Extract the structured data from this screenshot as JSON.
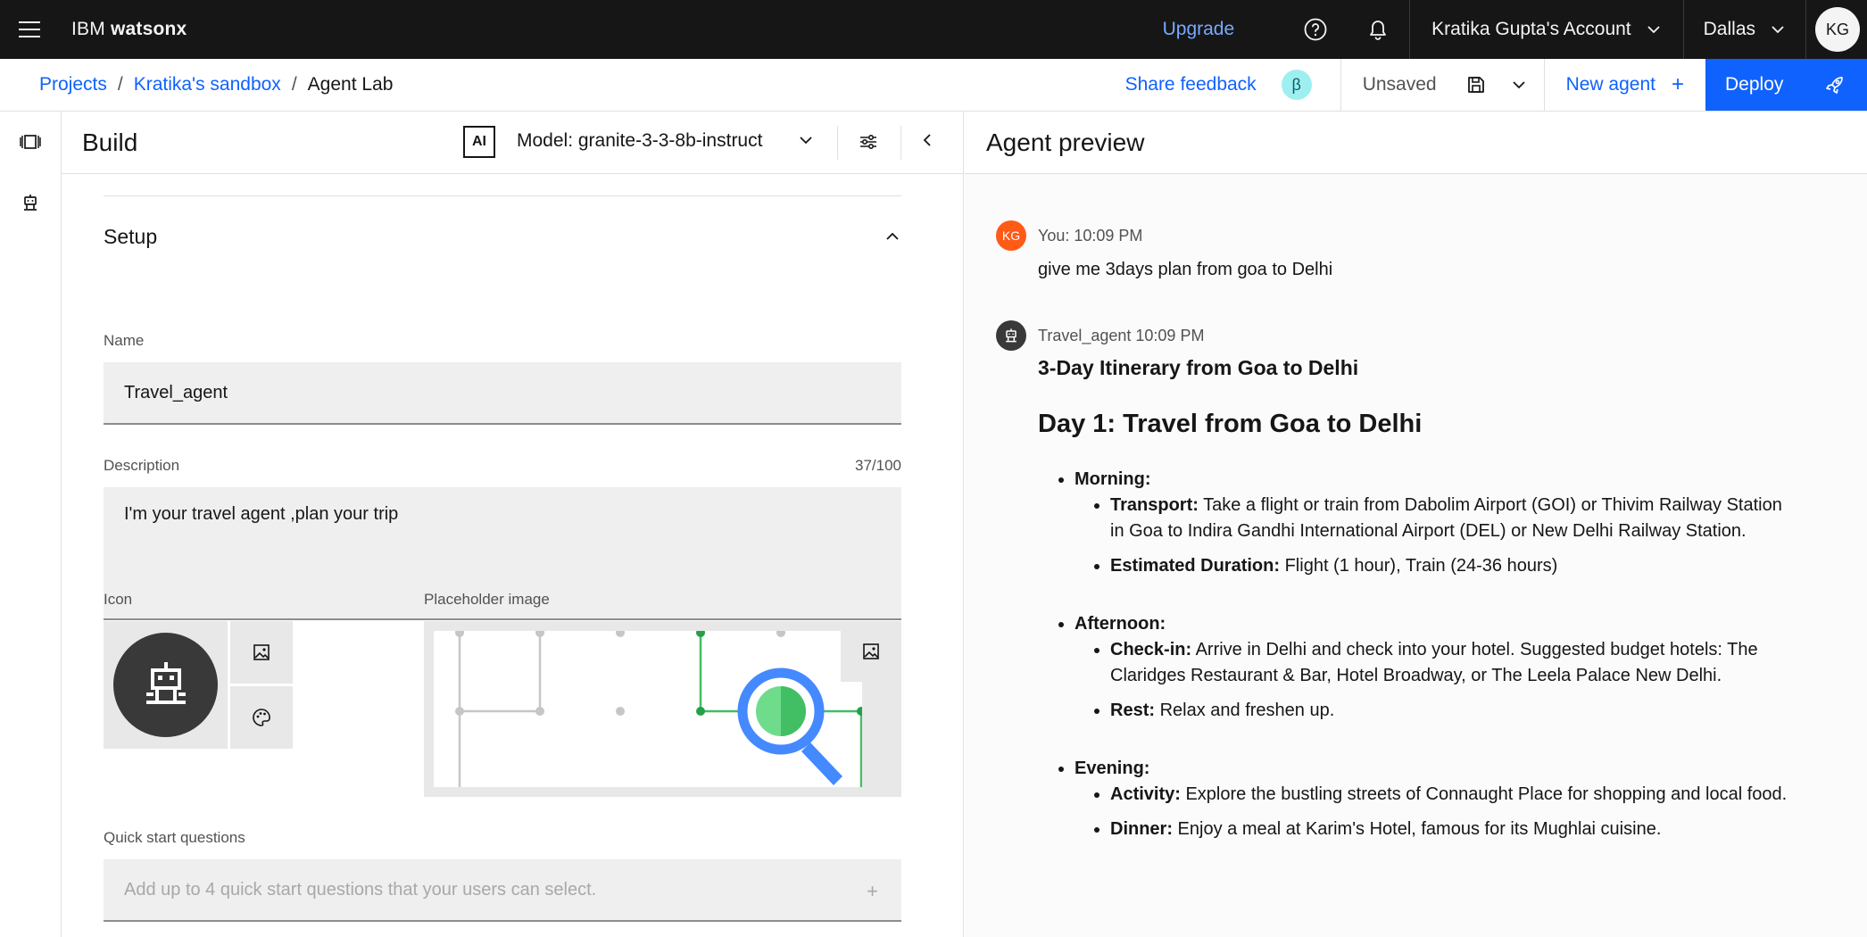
{
  "topbar": {
    "brand_prefix": "IBM ",
    "brand_product": "watsonx",
    "upgrade_label": "Upgrade",
    "account_label": "Kratika Gupta's Account",
    "region_label": "Dallas",
    "avatar_initials": "KG"
  },
  "subbar": {
    "breadcrumbs": [
      "Projects",
      "Kratika's sandbox",
      "Agent Lab"
    ],
    "share_feedback_label": "Share feedback",
    "beta_label": "β",
    "unsaved_label": "Unsaved",
    "new_agent_label": "New agent",
    "new_agent_plus": "+",
    "deploy_label": "Deploy"
  },
  "build": {
    "title": "Build",
    "ai_badge": "AI",
    "model_label": "Model: granite-3-3-8b-instruct",
    "setup_title": "Setup",
    "name_label": "Name",
    "name_value": "Travel_agent",
    "description_label": "Description",
    "description_counter": "37/100",
    "description_value": "I'm your travel agent ,plan your trip",
    "icon_label": "Icon",
    "placeholder_image_label": "Placeholder image",
    "quick_start_label": "Quick start questions",
    "quick_start_placeholder": "Add up to 4 quick start questions that your users can select.",
    "quick_start_plus": "+"
  },
  "preview": {
    "title": "Agent preview",
    "user_avatar": "KG",
    "user_meta": "You: 10:09 PM",
    "user_message": "give me 3days plan from goa to Delhi",
    "agent_meta": "Travel_agent 10:09 PM",
    "response": {
      "heading": "3-Day Itinerary from Goa to Delhi",
      "day_title": "Day 1: Travel from Goa to Delhi",
      "sections": [
        {
          "name": "Morning:",
          "items": [
            {
              "key": "Transport:",
              "text": " Take a flight or train from Dabolim Airport (GOI) or Thivim Railway Station in Goa to Indira Gandhi International Airport (DEL) or New Delhi Railway Station."
            },
            {
              "key": "Estimated Duration:",
              "text": " Flight (1 hour), Train (24-36 hours)"
            }
          ]
        },
        {
          "name": "Afternoon:",
          "items": [
            {
              "key": "Check-in:",
              "text": " Arrive in Delhi and check into your hotel. Suggested budget hotels: The Claridges Restaurant & Bar, Hotel Broadway, or The Leela Palace New Delhi."
            },
            {
              "key": "Rest:",
              "text": " Relax and freshen up."
            }
          ]
        },
        {
          "name": "Evening:",
          "items": [
            {
              "key": "Activity:",
              "text": " Explore the bustling streets of Connaught Place for shopping and local food."
            },
            {
              "key": "Dinner:",
              "text": " Enjoy a meal at Karim's Hotel, famous for its Mughlai cuisine."
            }
          ]
        }
      ]
    }
  },
  "colors": {
    "topbar_bg": "#161616",
    "link_blue": "#0f62fe",
    "upgrade_blue": "#78a9ff",
    "deploy_bg": "#0f62fe",
    "user_avatar_bg": "#ff5a16",
    "beta_bg": "#9ef0f0"
  }
}
